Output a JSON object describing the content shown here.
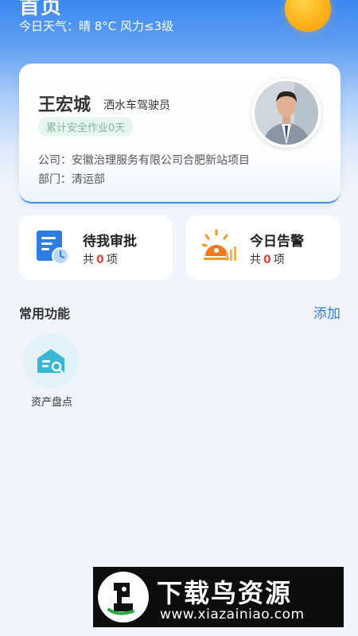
{
  "header": {
    "title": "首页",
    "weather": "今日天气：晴 8°C 风力≤3级",
    "sun_color": "#ffb21a"
  },
  "profile": {
    "name": "王宏城",
    "role": "洒水车驾驶员",
    "safety_badge": "累计安全作业0天",
    "company": "公司：安徽治理服务有限公司合肥新站项目",
    "department": "部门：清运部",
    "avatar_icon": "user-photo"
  },
  "stats": {
    "approval": {
      "title": "待我审批",
      "prefix": "共",
      "count": "0",
      "suffix": "项",
      "icon": "document-clock-icon"
    },
    "alarm": {
      "title": "今日告警",
      "prefix": "共",
      "count": "0",
      "suffix": "项",
      "icon": "sun-alert-icon"
    }
  },
  "functions": {
    "section_title": "常用功能",
    "add_label": "添加",
    "items": [
      {
        "label": "资产盘点",
        "icon": "asset-inventory-icon"
      }
    ]
  },
  "watermark": {
    "title": "下载鸟资源",
    "url": "www.xiazainiao.com"
  },
  "colors": {
    "accent": "#2d7ee0",
    "count_red": "#e8443a",
    "badge_green": "#7fb79c"
  }
}
